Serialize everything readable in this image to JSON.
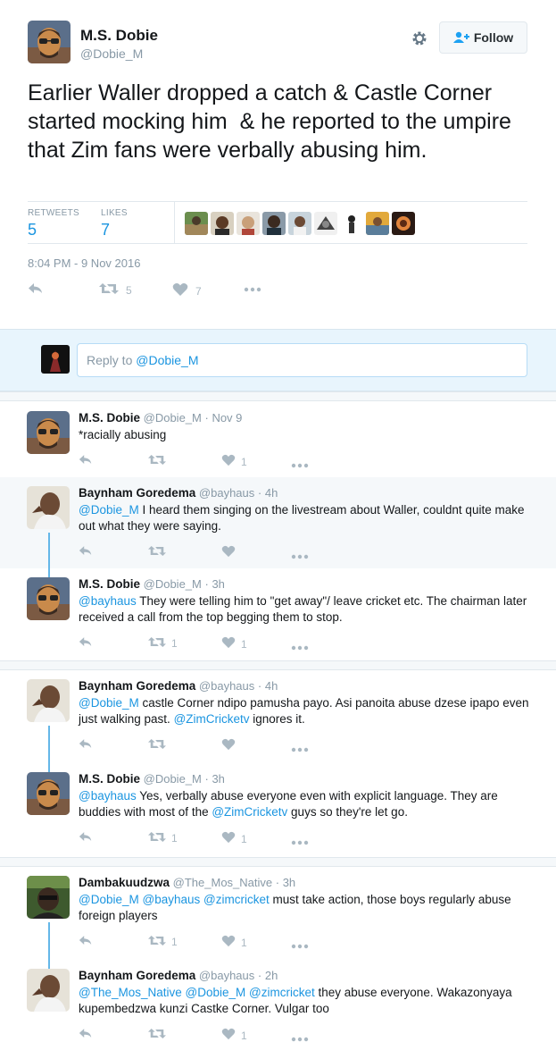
{
  "main_tweet": {
    "name": "M.S. Dobie",
    "handle": "@Dobie_M",
    "follow_label": "Follow",
    "text": "Earlier Waller dropped a catch & Castle Corner started mocking him  & he reported to the umpire  that Zim fans were verbally abusing him.",
    "retweets_label": "RETWEETS",
    "retweets": "5",
    "likes_label": "LIKES",
    "likes": "7",
    "timestamp": "8:04 PM - 9 Nov 2016",
    "action_retweet_count": "5",
    "action_like_count": "7"
  },
  "reply_box": {
    "prefix": "Reply to ",
    "mention": "@Dobie_M"
  },
  "replies": [
    {
      "name": "M.S. Dobie",
      "handle": "@Dobie_M",
      "time": "· Nov 9",
      "segments": [
        {
          "t": "*racially abusing",
          "l": false
        }
      ],
      "retweets": "",
      "likes": "1"
    },
    {
      "name": "Baynham Goredema",
      "handle": "@bayhaus",
      "time": "· 4h",
      "segments": [
        {
          "t": "@Dobie_M",
          "l": true
        },
        {
          "t": " I heard them singing on the livestream about Waller, couldnt quite make out what they were saying.",
          "l": false
        }
      ],
      "retweets": "",
      "likes": ""
    },
    {
      "name": "M.S. Dobie",
      "handle": "@Dobie_M",
      "time": "· 3h",
      "segments": [
        {
          "t": "@bayhaus",
          "l": true
        },
        {
          "t": " They were telling him to \"get away\"/ leave cricket etc. The chairman later received a call from the top begging them to stop.",
          "l": false
        }
      ],
      "retweets": "1",
      "likes": "1"
    },
    {
      "name": "Baynham Goredema",
      "handle": "@bayhaus",
      "time": "· 4h",
      "segments": [
        {
          "t": "@Dobie_M",
          "l": true
        },
        {
          "t": " castle Corner ndipo pamusha payo. Asi panoita abuse dzese ipapo even just walking past. ",
          "l": false
        },
        {
          "t": "@ZimCricketv",
          "l": true
        },
        {
          "t": " ignores it.",
          "l": false
        }
      ],
      "retweets": "",
      "likes": ""
    },
    {
      "name": "M.S. Dobie",
      "handle": "@Dobie_M",
      "time": "· 3h",
      "segments": [
        {
          "t": "@bayhaus",
          "l": true
        },
        {
          "t": " Yes, verbally abuse everyone even with explicit language. They are buddies with most of the ",
          "l": false
        },
        {
          "t": "@ZimCricketv",
          "l": true
        },
        {
          "t": " guys so they're let go.",
          "l": false
        }
      ],
      "retweets": "1",
      "likes": "1"
    },
    {
      "name": "Dambakuudzwa",
      "handle": "@The_Mos_Native",
      "time": "· 3h",
      "segments": [
        {
          "t": "@Dobie_M",
          "l": true
        },
        {
          "t": " ",
          "l": false
        },
        {
          "t": "@bayhaus",
          "l": true
        },
        {
          "t": " ",
          "l": false
        },
        {
          "t": "@zimcricket",
          "l": true
        },
        {
          "t": " must take action, those boys regularly abuse foreign players",
          "l": false
        }
      ],
      "retweets": "1",
      "likes": "1"
    },
    {
      "name": "Baynham Goredema",
      "handle": "@bayhaus",
      "time": "· 2h",
      "segments": [
        {
          "t": "@The_Mos_Native",
          "l": true
        },
        {
          "t": " ",
          "l": false
        },
        {
          "t": "@Dobie_M",
          "l": true
        },
        {
          "t": " ",
          "l": false
        },
        {
          "t": "@zimcricket",
          "l": true
        },
        {
          "t": " they abuse everyone. Wakazonyaya kupembedzwa kunzi Castke Corner. Vulgar too",
          "l": false
        }
      ],
      "retweets": "",
      "likes": "1"
    }
  ],
  "colors": {
    "link": "#1b95e0",
    "muted": "#8899a6",
    "thread_line": "#64b7e8",
    "reply_bg": "#e8f5fd"
  },
  "icons": [
    "settings-gear-icon",
    "follow-person-icon",
    "reply-icon",
    "retweet-icon",
    "like-heart-icon",
    "more-dots-icon"
  ]
}
